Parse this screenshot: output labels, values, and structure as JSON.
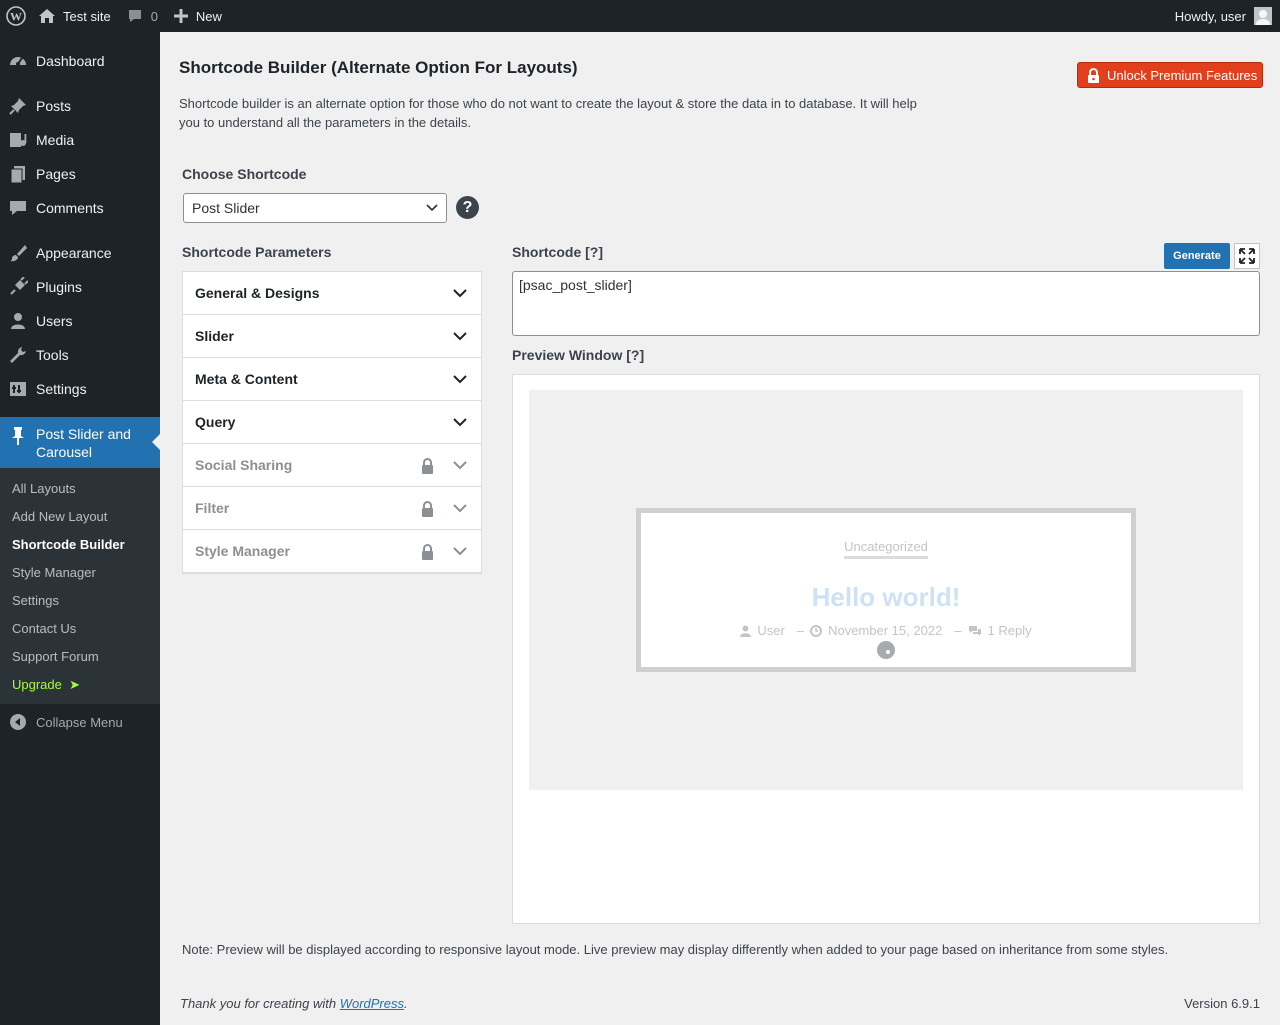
{
  "adminbar": {
    "site_name": "Test site",
    "comments_count": "0",
    "new_label": "New",
    "greeting": "Howdy, user"
  },
  "sidebar": {
    "items": [
      {
        "label": "Dashboard",
        "icon": "dashboard-icon"
      },
      {
        "label": "Posts",
        "icon": "pin-icon"
      },
      {
        "label": "Media",
        "icon": "media-icon"
      },
      {
        "label": "Pages",
        "icon": "pages-icon"
      },
      {
        "label": "Comments",
        "icon": "comment-icon"
      },
      {
        "label": "Appearance",
        "icon": "brush-icon"
      },
      {
        "label": "Plugins",
        "icon": "plug-icon"
      },
      {
        "label": "Users",
        "icon": "user-icon"
      },
      {
        "label": "Tools",
        "icon": "wrench-icon"
      },
      {
        "label": "Settings",
        "icon": "settings-icon"
      }
    ],
    "current": {
      "label": "Post Slider and Carousel",
      "icon": "pin-icon"
    },
    "submenu": [
      {
        "label": "All Layouts"
      },
      {
        "label": "Add New Layout"
      },
      {
        "label": "Shortcode Builder",
        "current": true
      },
      {
        "label": "Style Manager"
      },
      {
        "label": "Settings"
      },
      {
        "label": "Contact Us"
      },
      {
        "label": "Support Forum"
      },
      {
        "label": "Upgrade",
        "suffix": "➤"
      }
    ],
    "collapse_label": "Collapse Menu"
  },
  "main": {
    "title": "Shortcode Builder (Alternate Option For Layouts)",
    "premium_button": "Unlock Premium Features",
    "intro_line1": "Shortcode builder is an alternate option for those who do not want to create the layout & store the data in to database. It will help",
    "intro_line2": "you to understand all the parameters in the details.",
    "choose_label": "Choose Shortcode",
    "select_value": "Post Slider",
    "help": "?",
    "params_label": "Shortcode Parameters",
    "params": [
      {
        "label": "General & Designs",
        "locked": false
      },
      {
        "label": "Slider",
        "locked": false
      },
      {
        "label": "Meta & Content",
        "locked": false
      },
      {
        "label": "Query",
        "locked": false
      },
      {
        "label": "Social Sharing",
        "locked": true
      },
      {
        "label": "Filter",
        "locked": true
      },
      {
        "label": "Style Manager",
        "locked": true
      }
    ],
    "shortcode_label": "Shortcode [?]",
    "generate_button": "Generate",
    "shortcode_value": "[psac_post_slider]",
    "preview_label": "Preview Window [?]",
    "preview": {
      "category": "Uncategorized",
      "post_title": "Hello world!",
      "author": "User",
      "date": "November 15, 2022",
      "comments": "1 Reply",
      "separator": "–"
    },
    "note": "Note: Preview will be displayed according to responsive layout mode. Live preview may display differently when added to your page based on inheritance from some styles."
  },
  "footer": {
    "thanks_prefix": "Thank you for creating with ",
    "thanks_link": "WordPress",
    "thanks_suffix": ".",
    "version": "Version 6.9.1"
  },
  "colors": {
    "admin_dark": "#1d2327",
    "accent_blue": "#2271b1",
    "premium_red": "#e2401c",
    "upgrade_green": "#a3ff3c"
  }
}
